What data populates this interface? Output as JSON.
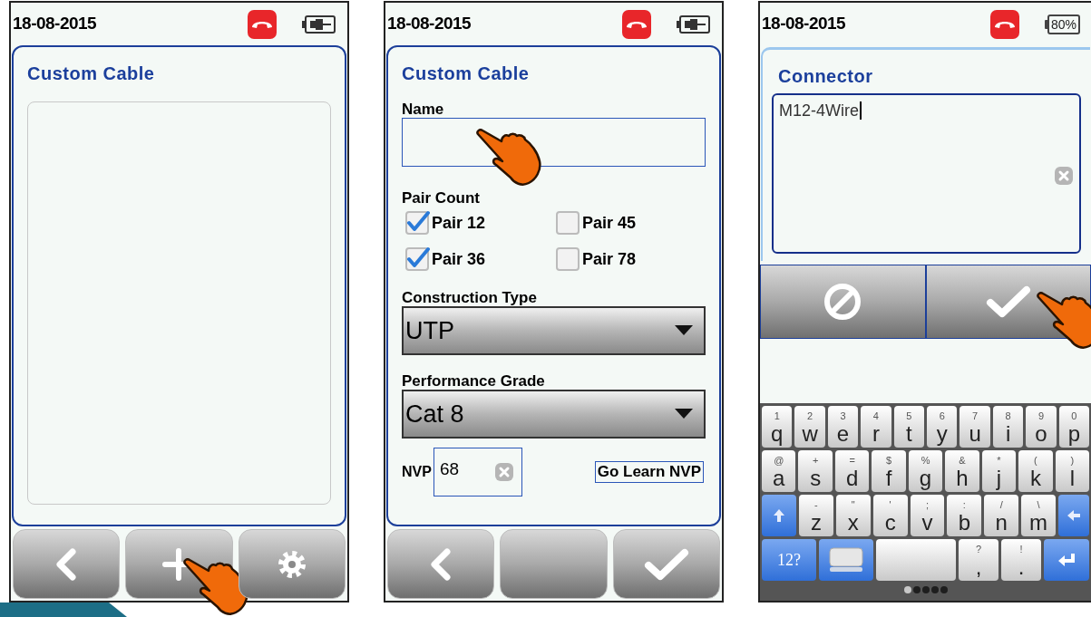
{
  "screens": [
    {
      "kind": "list",
      "date": "18-08-2015",
      "battery": {
        "kind": "plug"
      },
      "title": "Custom Cable",
      "buttons": [
        {
          "kind": "back",
          "pointed": false
        },
        {
          "kind": "add",
          "pointed": true
        },
        {
          "kind": "settings",
          "pointed": false
        }
      ]
    },
    {
      "kind": "form",
      "date": "18-08-2015",
      "battery": {
        "kind": "plug"
      },
      "title": "Custom Cable",
      "name_field": {
        "label": "Name",
        "pointed": true
      },
      "pair_count": {
        "label": "Pair Count",
        "pairs": [
          {
            "label": "Pair 12",
            "checked": true
          },
          {
            "label": "Pair 45",
            "checked": false
          },
          {
            "label": "Pair 36",
            "checked": true
          },
          {
            "label": "Pair 78",
            "checked": false
          }
        ]
      },
      "construction_type": {
        "label": "Construction Type",
        "value": "UTP"
      },
      "performance_grade": {
        "label": "Performance Grade",
        "value": "Cat 8"
      },
      "nvp": {
        "label": "NVP",
        "value": "68"
      },
      "learn_button": "Go Learn NVP",
      "buttons": [
        {
          "kind": "back",
          "pointed": false
        },
        {
          "kind": "blank",
          "pointed": false
        },
        {
          "kind": "ok",
          "pointed": false
        }
      ]
    },
    {
      "kind": "editor",
      "date": "18-08-2015",
      "battery": {
        "kind": "level",
        "text": "80%"
      },
      "title": "Connector",
      "value": "M12-4Wire",
      "buttons": [
        {
          "kind": "cancel",
          "pointed": false
        },
        {
          "kind": "ok",
          "pointed": true
        }
      ],
      "keyboard": {
        "rows": [
          {
            "keys": [
              {
                "kind": "char",
                "main": "q",
                "alt": "1"
              },
              {
                "kind": "char",
                "main": "w",
                "alt": "2"
              },
              {
                "kind": "char",
                "main": "e",
                "alt": "3"
              },
              {
                "kind": "char",
                "main": "r",
                "alt": "4"
              },
              {
                "kind": "char",
                "main": "t",
                "alt": "5"
              },
              {
                "kind": "char",
                "main": "y",
                "alt": "6"
              },
              {
                "kind": "char",
                "main": "u",
                "alt": "7"
              },
              {
                "kind": "char",
                "main": "i",
                "alt": "8"
              },
              {
                "kind": "char",
                "main": "o",
                "alt": "9"
              },
              {
                "kind": "char",
                "main": "p",
                "alt": "0"
              }
            ]
          },
          {
            "keys": [
              {
                "kind": "char",
                "main": "a",
                "alt": "@"
              },
              {
                "kind": "char",
                "main": "s",
                "alt": "+"
              },
              {
                "kind": "char",
                "main": "d",
                "alt": "="
              },
              {
                "kind": "char",
                "main": "f",
                "alt": "$"
              },
              {
                "kind": "char",
                "main": "g",
                "alt": "%"
              },
              {
                "kind": "char",
                "main": "h",
                "alt": "&"
              },
              {
                "kind": "char",
                "main": "j",
                "alt": "*"
              },
              {
                "kind": "char",
                "main": "k",
                "alt": "("
              },
              {
                "kind": "char",
                "main": "l",
                "alt": ")"
              }
            ]
          },
          {
            "keys": [
              {
                "kind": "shift"
              },
              {
                "kind": "char",
                "main": "z",
                "alt": "-"
              },
              {
                "kind": "char",
                "main": "x",
                "alt": "\""
              },
              {
                "kind": "char",
                "main": "c",
                "alt": "'"
              },
              {
                "kind": "char",
                "main": "v",
                "alt": ";"
              },
              {
                "kind": "char",
                "main": "b",
                "alt": ":"
              },
              {
                "kind": "char",
                "main": "n",
                "alt": "/"
              },
              {
                "kind": "char",
                "main": "m",
                "alt": "\\"
              },
              {
                "kind": "backspace"
              }
            ]
          },
          {
            "keys": [
              {
                "kind": "mode",
                "label": "12?"
              },
              {
                "kind": "layout"
              },
              {
                "kind": "space"
              },
              {
                "kind": "char",
                "main": ",",
                "alt": "?"
              },
              {
                "kind": "char",
                "main": ".",
                "alt": "!"
              },
              {
                "kind": "enter"
              }
            ]
          }
        ],
        "pages": [
          {
            "selected": true
          },
          {
            "selected": false
          },
          {
            "selected": false
          },
          {
            "selected": false
          },
          {
            "selected": false
          }
        ]
      }
    }
  ]
}
